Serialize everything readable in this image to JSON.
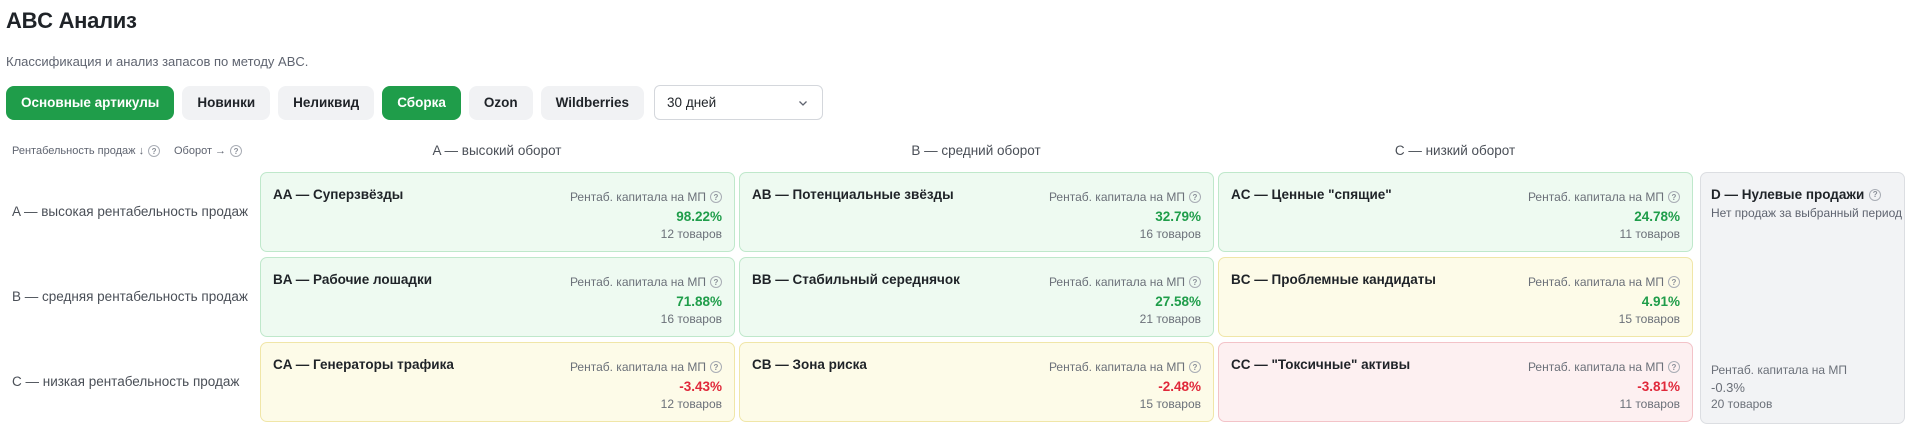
{
  "header": {
    "title": "ABC Анализ",
    "subtitle": "Классификация и анализ запасов по методу ABC."
  },
  "filters": {
    "chips": [
      {
        "label": "Основные артикулы",
        "active": true
      },
      {
        "label": "Новинки",
        "active": false
      },
      {
        "label": "Неликвид",
        "active": false
      },
      {
        "label": "Сборка",
        "active": true
      },
      {
        "label": "Ozon",
        "active": false
      },
      {
        "label": "Wildberries",
        "active": false
      }
    ],
    "period": {
      "value": "30 дней"
    }
  },
  "matrix": {
    "axis_row_label": "Рентабельность продаж ↓",
    "axis_col_label": "Оборот →",
    "columns": [
      "A — высокий оборот",
      "B — средний оборот",
      "C — низкий оборот"
    ],
    "rows": [
      "A — высокая рентабельность продаж",
      "B — средняя рентабельность продаж",
      "C — низкая рентабельность продаж"
    ],
    "metric_label": "Рентаб. капитала на МП",
    "cells": [
      {
        "title": "AA — Суперзвёзды",
        "value": "98.22%",
        "count": "12 товаров"
      },
      {
        "title": "AB — Потенциальные звёзды",
        "value": "32.79%",
        "count": "16 товаров"
      },
      {
        "title": "AC — Ценные \"спящие\"",
        "value": "24.78%",
        "count": "11 товаров"
      },
      {
        "title": "BA — Рабочие лошадки",
        "value": "71.88%",
        "count": "16 товаров"
      },
      {
        "title": "BB — Стабильный середнячок",
        "value": "27.58%",
        "count": "21 товаров"
      },
      {
        "title": "BC — Проблемные кандидаты",
        "value": "4.91%",
        "count": "15 товаров"
      },
      {
        "title": "CA — Генераторы трафика",
        "value": "-3.43%",
        "count": "12 товаров"
      },
      {
        "title": "CB — Зона риска",
        "value": "-2.48%",
        "count": "15 товаров"
      },
      {
        "title": "CC — \"Токсичные\" активы",
        "value": "-3.81%",
        "count": "11 товаров"
      }
    ],
    "zero_sales": {
      "title": "D — Нулевые продажи",
      "subtitle": "Нет продаж за выбранный период",
      "metric_label": "Рентаб. капитала на МП",
      "value": "-0.3%",
      "count": "20 товаров"
    }
  },
  "colors": {
    "accent": "#1f9d4a",
    "positive": "#1f9d4a",
    "negative": "#e0283a",
    "cell_green": "#eefaf1",
    "cell_yellow": "#fdfbe8",
    "cell_red": "#fdf0f1",
    "cell_grey": "#f2f3f5"
  }
}
